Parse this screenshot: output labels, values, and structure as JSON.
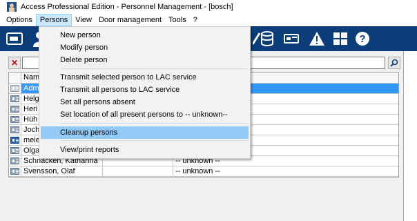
{
  "window": {
    "title": "Access Professional Edition - Personnel Management - [bosch]"
  },
  "menubar": [
    {
      "label": "Options",
      "active": false
    },
    {
      "label": "Persons",
      "active": true
    },
    {
      "label": "View",
      "active": false
    },
    {
      "label": "Door management",
      "active": false
    },
    {
      "label": "Tools",
      "active": false
    },
    {
      "label": "?",
      "active": false
    }
  ],
  "toolbar": {
    "icons": [
      "card-icon",
      "person-icon",
      "person-icon",
      "database-icon",
      "reader-icon",
      "warning-icon",
      "grid-icon",
      "help-icon"
    ],
    "background": "#0a3d7a"
  },
  "search": {
    "value": ""
  },
  "grid": {
    "header": {
      "name": "Nam"
    },
    "rows": [
      {
        "name": "Adm",
        "col2": "",
        "col3": "",
        "selected": true,
        "icon": "person-card-icon"
      },
      {
        "name": "Helg",
        "col2": "",
        "col3": "",
        "selected": false,
        "icon": "person-card-icon"
      },
      {
        "name": "Heri",
        "col2": "",
        "col3": "",
        "selected": false,
        "icon": "person-card-icon"
      },
      {
        "name": "Hüh",
        "col2": "",
        "col3": "",
        "selected": false,
        "icon": "person-card-icon"
      },
      {
        "name": "Joch",
        "col2": "",
        "col3": "",
        "selected": false,
        "icon": "person-card-icon"
      },
      {
        "name": "meie",
        "col2": "",
        "col3": "",
        "selected": false,
        "icon": "person-card-blue-icon"
      },
      {
        "name": "Olga",
        "col2": "",
        "col3": "",
        "selected": false,
        "icon": "person-card-icon"
      },
      {
        "name": "Schnacken, Katharina",
        "col2": "",
        "col3": "-- unknown --",
        "selected": false,
        "icon": "person-card-icon"
      },
      {
        "name": "Svensson, Olaf",
        "col2": "",
        "col3": "-- unknown --",
        "selected": false,
        "icon": "person-card-icon"
      }
    ]
  },
  "persons_menu": {
    "items": [
      {
        "label": "New person"
      },
      {
        "label": "Modify person"
      },
      {
        "label": "Delete person"
      },
      {
        "label": "Transmit selected person to LAC service"
      },
      {
        "label": "Transmit all persons to LAC service"
      },
      {
        "label": "Set all persons absent"
      },
      {
        "label": "Set location of all  present persons to -- unknown--"
      },
      {
        "label": "Cleanup persons",
        "highlighted": true
      },
      {
        "label": "View/print reports"
      }
    ]
  }
}
